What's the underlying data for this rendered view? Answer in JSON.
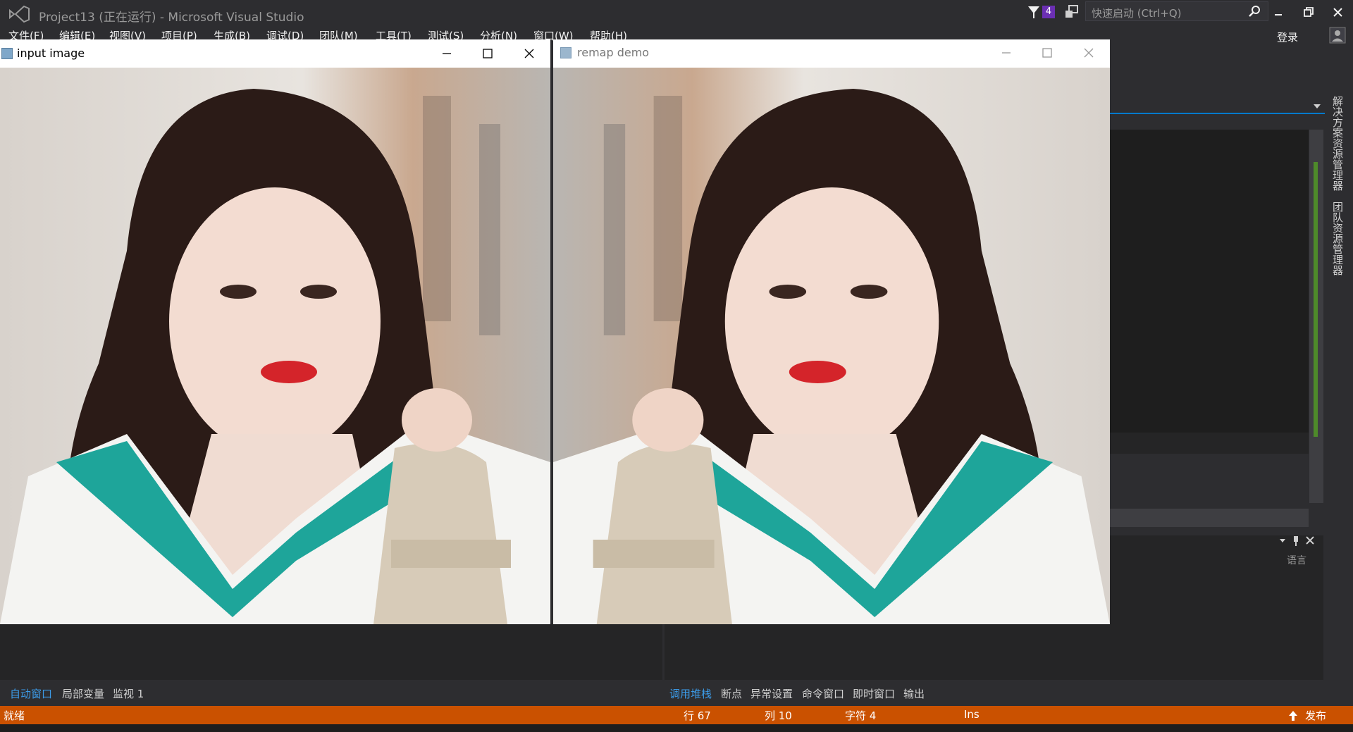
{
  "titlebar": {
    "title": "Project13 (正在运行) - Microsoft Visual Studio",
    "notification_count": "4",
    "quick_launch_placeholder": "快速启动 (Ctrl+Q)"
  },
  "menu": [
    "文件(F)",
    "编辑(E)",
    "视图(V)",
    "项目(P)",
    "生成(B)",
    "调试(D)",
    "团队(M)",
    "工具(T)",
    "测试(S)",
    "分析(N)",
    "窗口(W)",
    "帮助(H)"
  ],
  "account": {
    "login": "登录"
  },
  "right_sidebar": {
    "tabs": [
      "解决方案资源管理器",
      "团队资源管理器"
    ]
  },
  "output_pane": {
    "language_label": "语言"
  },
  "bottom_tabs_left": [
    {
      "label": "自动窗口",
      "active": true
    },
    {
      "label": "局部变量",
      "active": false
    },
    {
      "label": "监视 1",
      "active": false
    }
  ],
  "bottom_tabs_right": [
    {
      "label": "调用堆栈",
      "active": true
    },
    {
      "label": "断点",
      "active": false
    },
    {
      "label": "异常设置",
      "active": false
    },
    {
      "label": "命令窗口",
      "active": false
    },
    {
      "label": "即时窗口",
      "active": false
    },
    {
      "label": "输出",
      "active": false
    }
  ],
  "statusbar": {
    "state": "就绪",
    "line": "行 67",
    "col": "列 10",
    "char": "字符 4",
    "mode": "Ins",
    "publish": "发布"
  },
  "windows": [
    {
      "title": "input image",
      "active": true
    },
    {
      "title": "remap demo",
      "active": false
    }
  ],
  "colors": {
    "statusbar": "#ca5100",
    "accent": "#007acc",
    "vs_bg": "#2d2d30"
  },
  "icons": [
    "vs-logo-icon",
    "filter-icon",
    "feedback-icon",
    "search-icon",
    "minimize-icon",
    "restore-icon",
    "close-icon",
    "account-icon",
    "maximize-icon",
    "pin-icon",
    "dropdown-icon",
    "publish-icon"
  ]
}
